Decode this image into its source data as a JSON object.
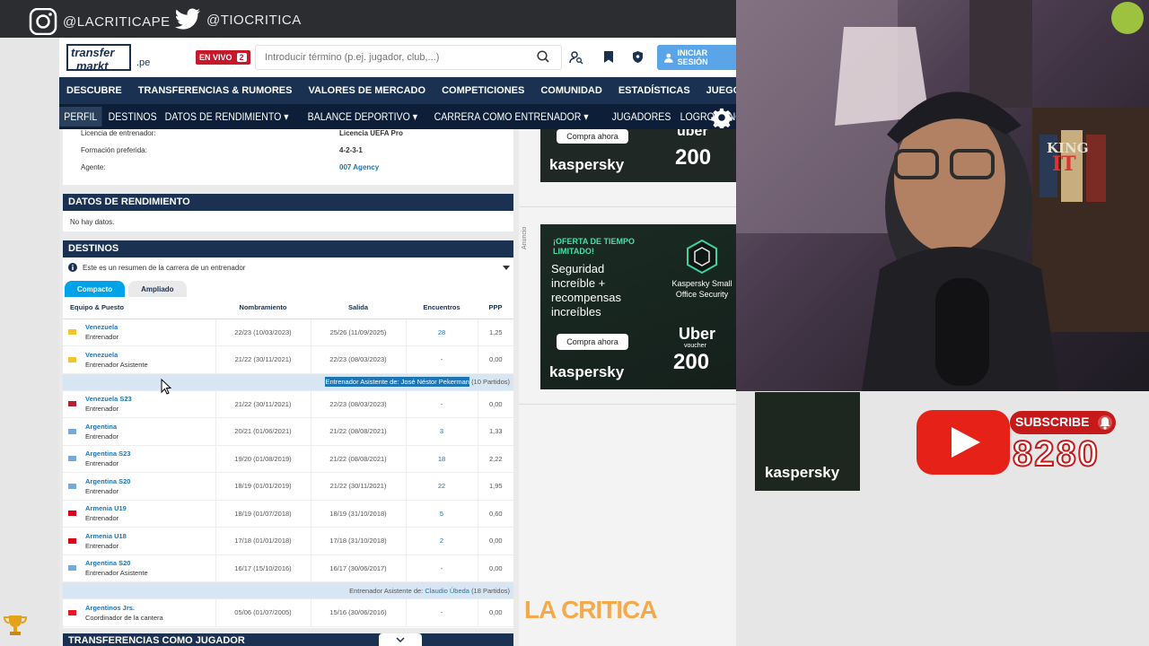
{
  "social": {
    "instagram": "@LACRITICAPE",
    "twitter": "@TIOCRITICA"
  },
  "header": {
    "logo_line1": "transfer",
    "logo_line2": "markt",
    "tld": ".pe",
    "live_label": "EN VIVO",
    "live_count": "2",
    "search_placeholder": "Introducir término (p.ej. jugador, club,...)",
    "login_label": "INICIAR SESIÓN"
  },
  "mainnav": [
    "DESCUBRE",
    "TRANSFERENCIAS & RUMORES",
    "VALORES DE MERCADO",
    "COMPETICIONES",
    "COMUNIDAD",
    "ESTADÍSTICAS",
    "JUEGOS"
  ],
  "subnav": [
    {
      "label": "PERFIL",
      "active": true
    },
    {
      "label": "DESTINOS"
    },
    {
      "label": "DATOS DE RENDIMIENTO ▾"
    },
    {
      "label": "BALANCE DEPORTIVO ▾"
    },
    {
      "label": "CARRERA COMO ENTRENADOR ▾"
    },
    {
      "label": "JUGADORES"
    },
    {
      "label": "LOGROS"
    },
    {
      "label": "NOTICIAS"
    }
  ],
  "profile": {
    "rows": [
      {
        "key": "Licencia de entrenador:",
        "value": "Licencia UEFA Pro"
      },
      {
        "key": "Formación preferida:",
        "value": "4-2-3-1"
      },
      {
        "key": "Agente:",
        "value": "007 Agency"
      }
    ]
  },
  "rendimiento": {
    "title": "DATOS DE RENDIMIENTO",
    "empty": "No hay datos."
  },
  "destinos": {
    "title": "DESTINOS",
    "info": "Este es un resumen de la carrera de un entrenador",
    "tabs": [
      "Compacto",
      "Ampliado"
    ],
    "columns": [
      "Equipo & Puesto",
      "Nombramiento",
      "Salida",
      "Encuentros",
      "PPP"
    ],
    "rows": [
      {
        "type": "row",
        "team": "Venezuela",
        "role": "Entrenador",
        "start": "22/23 (10/03/2023)",
        "end": "25/26 (11/09/2025)",
        "matches": "28",
        "ppp": "1,25",
        "flag": "#f4c430"
      },
      {
        "type": "row",
        "team": "Venezuela",
        "role": "Entrenador Asistente",
        "start": "21/22 (30/11/2021)",
        "end": "22/23 (08/03/2023)",
        "matches": "-",
        "ppp": "0,00",
        "flag": "#f4c430"
      },
      {
        "type": "sep",
        "highlight": "Entrenador Asistente de: José Néstor Pekerman",
        "suffix": "(10 Partidos)"
      },
      {
        "type": "row",
        "team": "Venezuela S23",
        "role": "Entrenador",
        "start": "21/22 (30/11/2021)",
        "end": "22/23 (08/03/2023)",
        "matches": "-",
        "ppp": "0,00",
        "flag": "#b22234"
      },
      {
        "type": "row",
        "team": "Argentina",
        "role": "Entrenador",
        "start": "20/21 (01/06/2021)",
        "end": "21/22 (08/08/2021)",
        "matches": "3",
        "ppp": "1,33",
        "flag": "#75aadb"
      },
      {
        "type": "row",
        "team": "Argentina S23",
        "role": "Entrenador",
        "start": "19/20 (01/08/2019)",
        "end": "21/22 (08/08/2021)",
        "matches": "18",
        "ppp": "2,22",
        "flag": "#75aadb"
      },
      {
        "type": "row",
        "team": "Argentina S20",
        "role": "Entrenador",
        "start": "18/19 (01/01/2019)",
        "end": "21/22 (30/11/2021)",
        "matches": "22",
        "ppp": "1,95",
        "flag": "#75aadb"
      },
      {
        "type": "row",
        "team": "Armenia U19",
        "role": "Entrenador",
        "start": "18/19 (01/07/2018)",
        "end": "18/19 (31/10/2018)",
        "matches": "5",
        "ppp": "0,60",
        "flag": "#d90012"
      },
      {
        "type": "row",
        "team": "Armenia U18",
        "role": "Entrenador",
        "start": "17/18 (01/01/2018)",
        "end": "17/18 (31/10/2018)",
        "matches": "2",
        "ppp": "0,00",
        "flag": "#d90012"
      },
      {
        "type": "row",
        "team": "Argentina S20",
        "role": "Entrenador Asistente",
        "start": "16/17 (15/10/2016)",
        "end": "16/17 (30/06/2017)",
        "matches": "-",
        "ppp": "0,00",
        "flag": "#75aadb"
      },
      {
        "type": "sep",
        "plain": "Entrenador Asistente de:",
        "link": "Claudio Úbeda",
        "suffix": "(18 Partidos)"
      },
      {
        "type": "row",
        "team": "Argentinos Jrs.",
        "role": "Coordinador de la cantera",
        "start": "05/06 (01/07/2005)",
        "end": "15/16 (30/06/2016)",
        "matches": "-",
        "ppp": "0,00",
        "flag": "#e21b23"
      }
    ]
  },
  "transferencias": {
    "title": "TRANSFERENCIAS COMO JUGADOR"
  },
  "ads": {
    "top": {
      "cta": "Compra ahora",
      "brand": "kaspersky",
      "voucher": "200",
      "uber": "uber"
    },
    "label": "Anuncio",
    "main": {
      "offer": "¡OFERTA DE TIEMPO LIMITADO!",
      "headline": "Seguridad increíble + recompensas increíbles",
      "product": "Kaspersky Small Office Security",
      "cta": "Compra ahora",
      "brand": "kaspersky",
      "uber": "Uber",
      "voucher_word": "voucher",
      "voucher": "200"
    }
  },
  "stream": {
    "tile_brand": "kaspersky",
    "subscribe": "SUBSCRIBE",
    "subscribers": "8280",
    "overlay": "LA CRITICA",
    "book_line1": "KING",
    "book_line2": "IT",
    "colors": {
      "youtube": "#e62117",
      "overlay": "#f4a94a",
      "tm_navy": "#1a3151"
    }
  }
}
